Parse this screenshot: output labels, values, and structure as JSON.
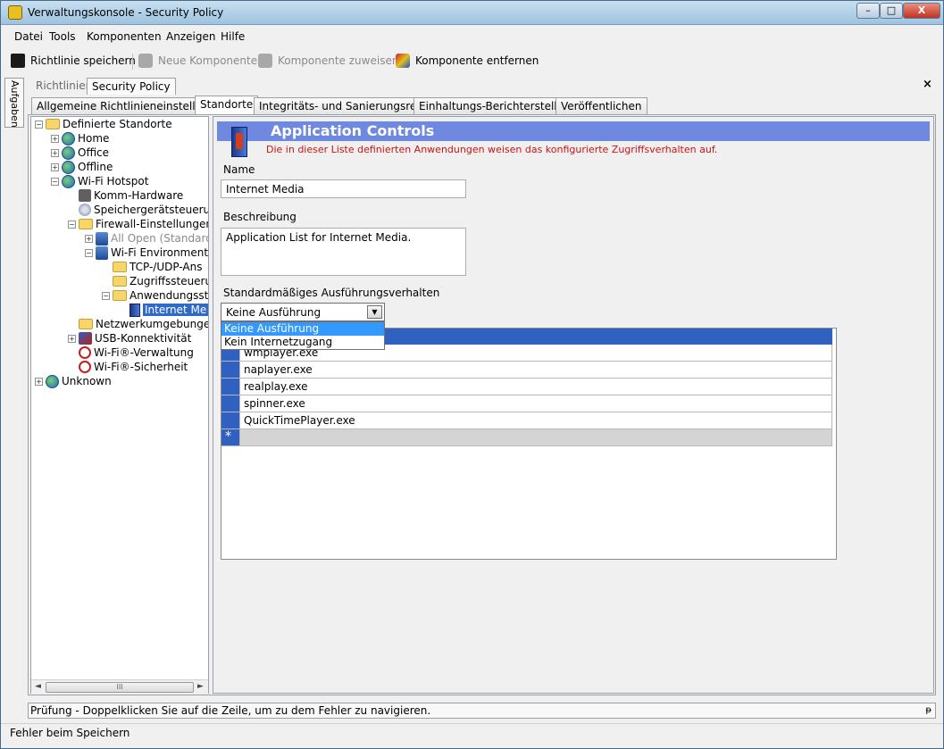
{
  "window": {
    "title": "Verwaltungskonsole - Security Policy",
    "buttons": {
      "minimize": "–",
      "maximize": "□",
      "close": "X"
    }
  },
  "menu": [
    "Datei",
    "Tools",
    "Komponenten",
    "Anzeigen",
    "Hilfe"
  ],
  "toolbar": {
    "save": "Richtlinie speichern",
    "new_component": "Neue Komponente",
    "assign_component": "Komponente zuweisen",
    "remove_component": "Komponente entfernen"
  },
  "side_tab": "Aufgaben",
  "doc_tabs": [
    "Richtlinien",
    "Security Policy"
  ],
  "close_label": "×",
  "main_tabs": [
    "Allgemeine Richtlinieneinstellungen",
    "Standorte",
    "Integritäts- und Sanierungsregeln",
    "Einhaltungs-Berichterstellung",
    "Veröffentlichen"
  ],
  "tree": [
    {
      "label": "Definierte Standorte",
      "icon": "folder-icon",
      "expander": "−"
    },
    {
      "label": "Home",
      "icon": "globe-icon",
      "expander": "+"
    },
    {
      "label": "Office",
      "icon": "globe-icon",
      "expander": "+"
    },
    {
      "label": "Offline",
      "icon": "globe-icon",
      "expander": "+"
    },
    {
      "label": "Wi-Fi Hotspot",
      "icon": "globe-icon",
      "expander": "−"
    },
    {
      "label": "Komm-Hardware",
      "icon": "gear-icon",
      "expander": ""
    },
    {
      "label": "Speichergerätsteuerun",
      "icon": "disk-icon",
      "expander": ""
    },
    {
      "label": "Firewall-Einstellungen",
      "icon": "folder-icon",
      "expander": "−"
    },
    {
      "label": "All Open (Standard)",
      "icon": "shield-icon",
      "expander": "+",
      "disabled": true
    },
    {
      "label": "Wi-Fi Environment",
      "icon": "shield-icon",
      "expander": "−"
    },
    {
      "label": "TCP-/UDP-Ans",
      "icon": "folder-icon",
      "expander": ""
    },
    {
      "label": "Zugriffssteuerun",
      "icon": "folder-icon",
      "expander": ""
    },
    {
      "label": "Anwendungsste",
      "icon": "folder-icon",
      "expander": "−"
    },
    {
      "label": "Internet Me",
      "icon": "book-icon",
      "expander": "",
      "selected": true
    },
    {
      "label": "Netzwerkumgebungen",
      "icon": "folder-icon",
      "expander": ""
    },
    {
      "label": "USB-Konnektivität",
      "icon": "usb-icon",
      "expander": "+"
    },
    {
      "label": "Wi-Fi®-Verwaltung",
      "icon": "wifi-icon",
      "expander": ""
    },
    {
      "label": "Wi-Fi®-Sicherheit",
      "icon": "wifi-icon",
      "expander": ""
    },
    {
      "label": "Unknown",
      "icon": "globe-icon",
      "expander": "+"
    }
  ],
  "tree_scroll": {
    "left": "◄",
    "right": "►",
    "grip": "III"
  },
  "panel": {
    "title": "Application Controls",
    "subtitle": "Die in dieser Liste definierten Anwendungen weisen das konfigurierte Zugriffsverhalten auf.",
    "name_label": "Name",
    "name_value": "Internet Media",
    "desc_label": "Beschreibung",
    "desc_value": "Application List for Internet Media.",
    "behavior_label": "Standardmäßiges Ausführungsverhalten",
    "behavior_value": "Keine Ausführung",
    "behavior_options": [
      "Keine Ausführung",
      "Kein Internetzugang"
    ],
    "arrow": "▼"
  },
  "grid": {
    "rows": [
      "wmplayer.exe",
      "naplayer.exe",
      "realplay.exe",
      "spinner.exe",
      "QuickTimePlayer.exe"
    ],
    "new_row_marker": "*"
  },
  "status_panel": "Prüfung - Doppelklicken Sie auf die Zeile, um zu dem Fehler zu navigieren.",
  "pin": "ᵽ",
  "statusbar": "Fehler beim Speichern",
  "colors": {
    "header_band": "#6f88e0",
    "selection": "#316ac5",
    "grid_blue": "#3060c0",
    "error_red": "#d01010"
  }
}
